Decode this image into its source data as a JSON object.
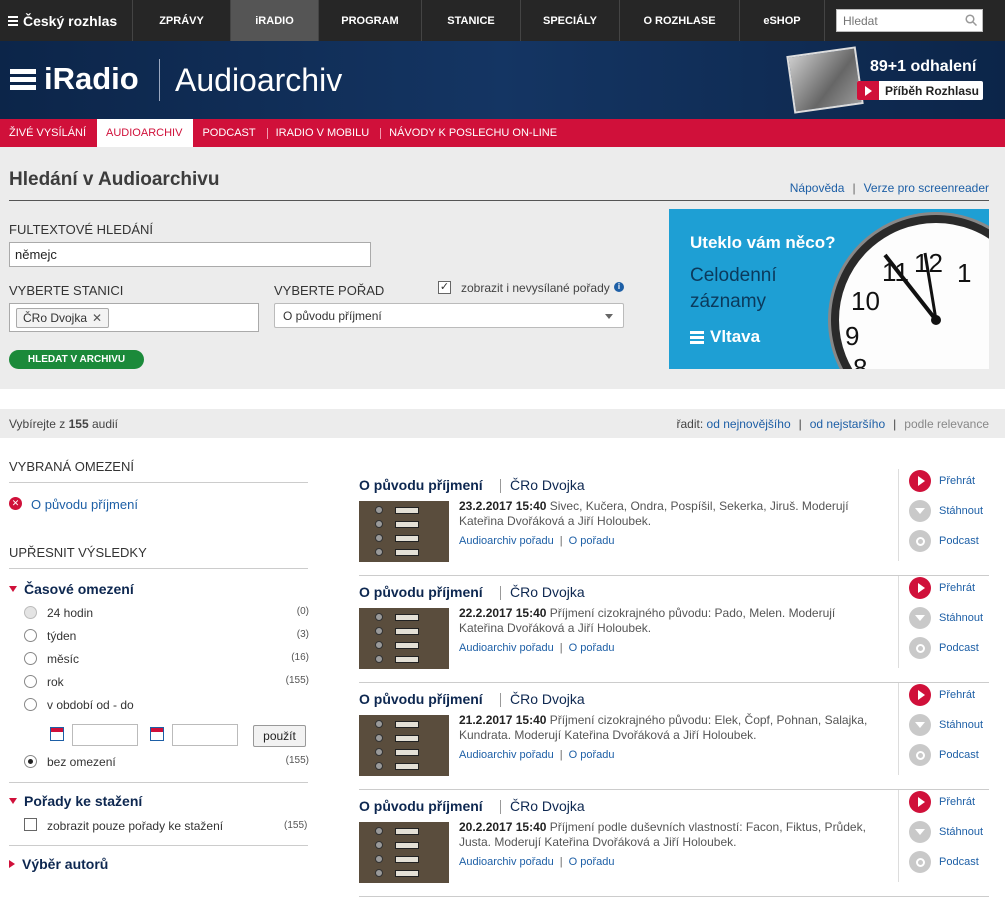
{
  "topnav": {
    "logo": "Český rozhlas",
    "items": [
      "ZPRÁVY",
      "iRADIO",
      "PROGRAM",
      "STANICE",
      "SPECIÁLY",
      "O ROZHLASE",
      "eSHOP"
    ],
    "search_placeholder": "Hledat"
  },
  "banner": {
    "brand": "iRadio",
    "section": "Audioarchiv",
    "promo_title": "89+1 odhalení",
    "promo_button": "Příběh Rozhlasu"
  },
  "subnav": [
    "ŽIVÉ VYSÍLÁNÍ",
    "AUDIOARCHIV",
    "PODCAST",
    "IRADIO V MOBILU",
    "NÁVODY K POSLECHU ON-LINE"
  ],
  "search": {
    "title": "Hledání v Audioarchivu",
    "help": "Nápověda",
    "screenreader": "Verze pro screenreader",
    "fulltext_label": "FULTEXTOVÉ HLEDÁNÍ",
    "fulltext_value": "němejc",
    "station_label": "VYBERTE STANICI",
    "station_value": "ČRo Dvojka",
    "program_label": "VYBERTE POŘAD",
    "program_value": "O původu příjmení",
    "unaired_label": "zobrazit i nevysílané pořady",
    "submit": "HLEDAT V ARCHIVU"
  },
  "ad": {
    "line1": "Uteklo vám něco?",
    "line2a": "Celodenní",
    "line2b": "záznamy",
    "logo": "Vltava",
    "clock_numbers": [
      "11",
      "12",
      "1",
      "10",
      "9",
      "8"
    ]
  },
  "results_header": {
    "prefix": "Vybírejte z",
    "count": "155",
    "suffix": "audií",
    "sort_label": "řadit:",
    "sort_newest": "od nejnovějšího",
    "sort_oldest": "od nejstaršího",
    "sort_relevance": "podle relevance"
  },
  "filters": {
    "selected_title": "VYBRANÁ OMEZENÍ",
    "selected_item": "O původu příjmení",
    "refine_title": "UPŘESNIT VÝSLEDKY",
    "time_title": "Časové omezení",
    "time_options": [
      {
        "label": "24 hodin",
        "count": "(0)"
      },
      {
        "label": "týden",
        "count": "(3)"
      },
      {
        "label": "měsíc",
        "count": "(16)"
      },
      {
        "label": "rok",
        "count": "(155)"
      },
      {
        "label": "v období od - do",
        "count": ""
      },
      {
        "label": "bez omezení",
        "count": "(155)"
      }
    ],
    "apply": "použít",
    "download_title": "Pořady ke stažení",
    "download_option": "zobrazit pouze pořady ke stažení",
    "download_count": "(155)",
    "authors_title": "Výběr autorů"
  },
  "results": [
    {
      "title": "O původu příjmení",
      "station": "ČRo Dvojka",
      "date": "23.2.2017 15:40",
      "text": "Sivec, Kučera, Ondra, Pospíšil, Sekerka, Jiruš. Moderují Kateřina Dvořáková a Jiří Holoubek."
    },
    {
      "title": "O původu příjmení",
      "station": "ČRo Dvojka",
      "date": "22.2.2017 15:40",
      "text": "Příjmení cizokrajného původu: Pado, Melen. Moderují Kateřina Dvořáková a Jiří Holoubek."
    },
    {
      "title": "O původu příjmení",
      "station": "ČRo Dvojka",
      "date": "21.2.2017 15:40",
      "text": "Příjmení cizokrajného původu: Elek, Čopf, Pohnan, Salajka, Kundrata. Moderují Kateřina Dvořáková a Jiří Holoubek."
    },
    {
      "title": "O původu příjmení",
      "station": "ČRo Dvojka",
      "date": "20.2.2017 15:40",
      "text": "Příjmení podle duševních vlastností: Facon, Fiktus, Průdek, Justa. Moderují Kateřina Dvořáková a Jiří Holoubek."
    }
  ],
  "result_links": {
    "archive": "Audioarchiv pořadu",
    "about": "O pořadu"
  },
  "result_actions": {
    "play": "Přehrát",
    "download": "Stáhnout",
    "podcast": "Podcast"
  },
  "colors": {
    "brand_red": "#d0103a",
    "navy": "#0d2750",
    "link_blue": "#1d5fa6",
    "button_green": "#1b8a3a"
  }
}
